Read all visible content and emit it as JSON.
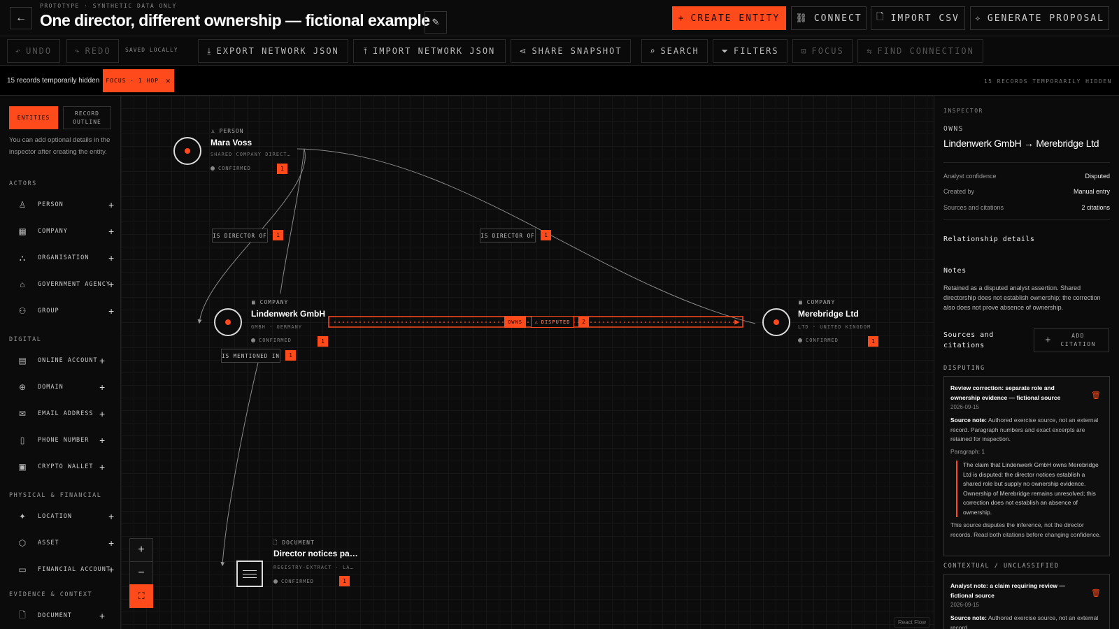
{
  "header": {
    "prototype_label": "PROTOTYPE · SYNTHETIC DATA ONLY",
    "title": "One director, different ownership — fictional example",
    "buttons": {
      "create_entity": "CREATE ENTITY",
      "connect": "CONNECT",
      "import_csv": "IMPORT CSV",
      "generate_proposal": "GENERATE PROPOSAL"
    }
  },
  "toolbar": {
    "undo": "UNDO",
    "redo": "REDO",
    "saved": "SAVED LOCALLY",
    "export_json": "EXPORT NETWORK JSON",
    "import_json": "IMPORT NETWORK JSON",
    "share": "SHARE SNAPSHOT",
    "search": "SEARCH",
    "filters": "FILTERS",
    "focus": "FOCUS",
    "find_connection": "FIND CONNECTION"
  },
  "status": {
    "hidden_left": "15 records temporarily hidden",
    "focus_pill": "FOCUS · 1 HOP",
    "hidden_right": "15 RECORDS TEMPORARILY HIDDEN"
  },
  "sidebar": {
    "tabs": {
      "entities": "ENTITIES",
      "outline": "RECORD OUTLINE"
    },
    "hint": "You can add optional details in the inspector after creating the entity.",
    "sections": {
      "actors": "ACTORS",
      "digital": "DIGITAL",
      "physical": "PHYSICAL & FINANCIAL",
      "evidence": "EVIDENCE & CONTEXT"
    },
    "items": {
      "person": "PERSON",
      "company": "COMPANY",
      "organisation": "ORGANISATION",
      "government_agency": "GOVERNMENT AGENCY",
      "group": "GROUP",
      "online_account": "ONLINE ACCOUNT",
      "domain": "DOMAIN",
      "email_address": "EMAIL ADDRESS",
      "phone_number": "PHONE NUMBER",
      "crypto_wallet": "CRYPTO WALLET",
      "location": "LOCATION",
      "asset": "ASSET",
      "financial_account": "FINANCIAL ACCOUNT",
      "document": "DOCUMENT"
    }
  },
  "graph": {
    "nodes": {
      "mara": {
        "type": "PERSON",
        "name": "Mara Voss",
        "sub": "SHARED COMPANY DIRECT…",
        "status": "CONFIRMED",
        "count": "1"
      },
      "lindenwerk": {
        "type": "COMPANY",
        "name": "Lindenwerk GmbH",
        "sub": "GMBH · GERMANY",
        "status": "CONFIRMED",
        "count": "1"
      },
      "merebridge": {
        "type": "COMPANY",
        "name": "Merebridge Ltd",
        "sub": "LTD · UNITED KINGDOM",
        "status": "CONFIRMED",
        "count": "1"
      },
      "document": {
        "type": "DOCUMENT",
        "name": "Director notices pa…",
        "sub": "REGISTRY-EXTRACT · LA…",
        "status": "CONFIRMED",
        "count": "1"
      }
    },
    "edges": {
      "director_1": {
        "label": "IS DIRECTOR OF",
        "count": "1"
      },
      "director_2": {
        "label": "IS DIRECTOR OF",
        "count": "1"
      },
      "mentioned": {
        "label": "IS MENTIONED IN",
        "count": "1"
      },
      "owns": {
        "label": "OWNS",
        "status": "DISPUTED",
        "count": "2"
      }
    },
    "watermark": "React Flow"
  },
  "inspector": {
    "label": "INSPECTOR",
    "relation_type": "OWNS",
    "relation_title": "Lindenwerk GmbH → Merebridge Ltd",
    "rows": [
      {
        "key": "Analyst confidence",
        "value": "Disputed"
      },
      {
        "key": "Created by",
        "value": "Manual entry"
      },
      {
        "key": "Sources and citations",
        "value": "2 citations"
      }
    ],
    "relationship_details": "Relationship details",
    "notes_label": "Notes",
    "notes": "Retained as a disputed analyst assertion. Shared directorship does not establish ownership; the correction also does not prove absence of ownership.",
    "sources_label": "Sources and citations",
    "add_citation": "ADD CITATION",
    "disputing_label": "DISPUTING",
    "disputing_card": {
      "title": "Review correction: separate role and ownership evidence — fictional source",
      "date": "2026-09-15",
      "source_note_label": "Source note:",
      "source_note": "Authored exercise source, not an external record. Paragraph numbers and exact excerpts are retained for inspection.",
      "paragraph": "Paragraph: 1",
      "quote": "The claim that Lindenwerk GmbH owns Merebridge Ltd is disputed: the director notices establish a shared role but supply no ownership evidence. Ownership of Merebridge remains unresolved; this correction does not establish an absence of ownership.",
      "footer": "This source disputes the inference, not the director records. Read both citations before changing confidence."
    },
    "contextual_label": "CONTEXTUAL / UNCLASSIFIED",
    "contextual_card": {
      "title": "Analyst note: a claim requiring review — fictional source",
      "date": "2026-09-15",
      "source_note_label": "Source note:",
      "source_note": "Authored exercise source, not an external record."
    }
  },
  "colors": {
    "accent": "#ff4a1c",
    "background": "#0a0a0a"
  }
}
